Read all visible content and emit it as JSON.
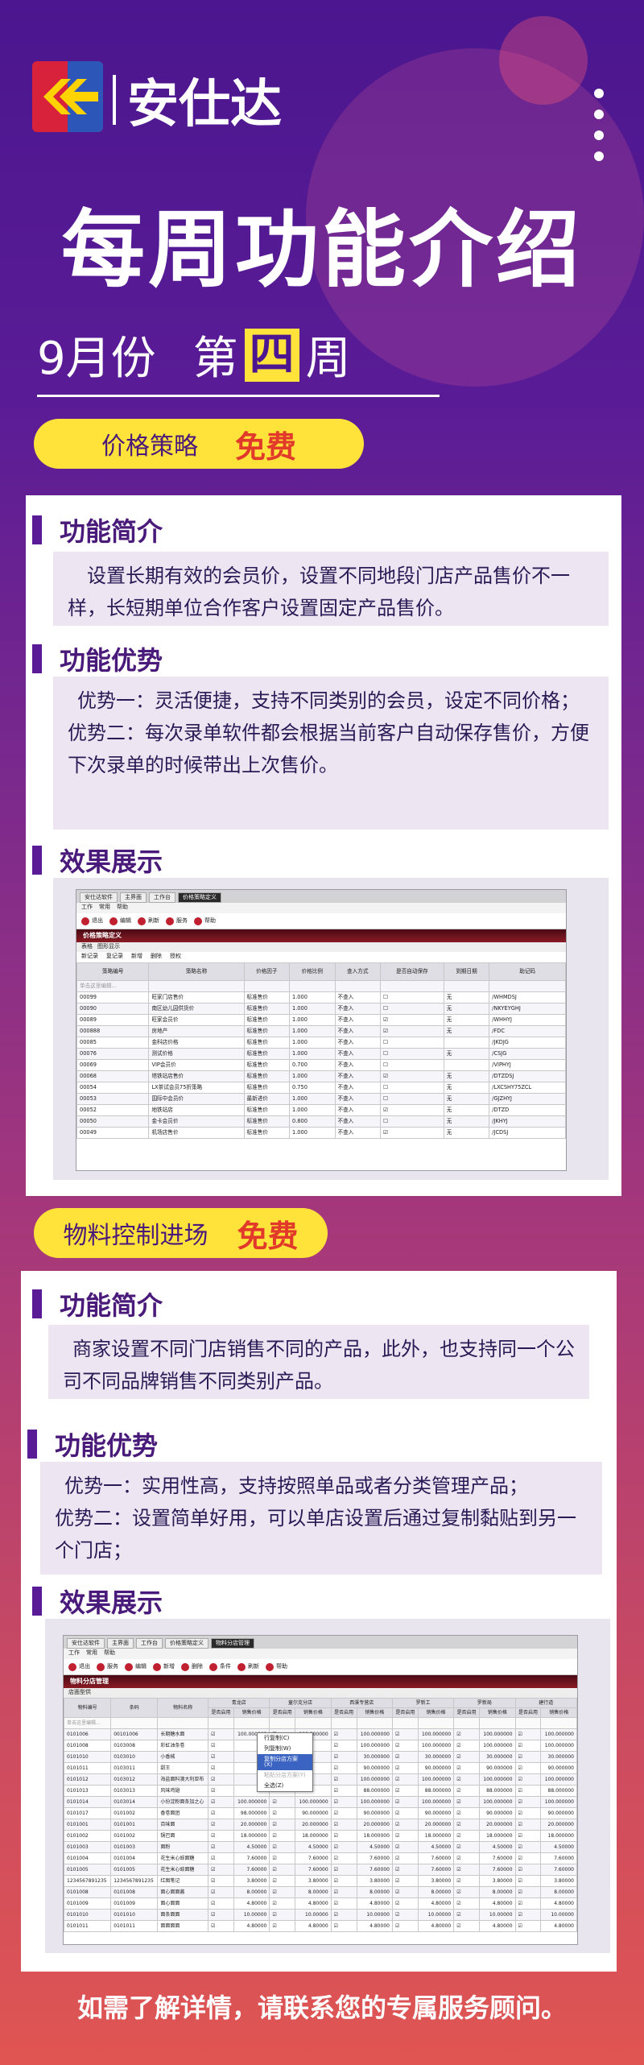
{
  "brand": {
    "name": "安仕达"
  },
  "poster": {
    "title": "每周功能介绍",
    "period_month": "9月份",
    "period_week_prefix": "第",
    "period_week_num": "四",
    "period_week_suffix": "周"
  },
  "feature1": {
    "name": "价格策略",
    "tag": "免费",
    "intro_title": "功能简介",
    "intro_text": "设置长期有效的会员价，设置不同地段门店产品售价不一样，长短期单位合作客户设置固定产品售价。",
    "adv_title": "功能优势",
    "adv_text1": "优势一：灵活便捷，支持不同类别的会员，设定不同价格；",
    "adv_text2": "优势二：每次录单软件都会根据当前客户自动保存售价，方便下次录单的时候带出上次售价。",
    "demo_title": "效果展示",
    "app": {
      "tabs": [
        "安仕达软件",
        "主界面",
        "工作台",
        "价格策略定义"
      ],
      "menu": [
        "工作",
        "常用",
        "帮助"
      ],
      "toolbar": [
        "退出",
        "编辑",
        "刷新",
        "服务",
        "帮助"
      ],
      "header": "价格策略定义",
      "subtabs": [
        "表格",
        "图形显示"
      ],
      "subtoolbar": [
        "新记录",
        "复记录",
        "新增",
        "删除",
        "授权"
      ],
      "columns": [
        "策略编号",
        "策略名称",
        "价格因子",
        "价格比例",
        "查入方式",
        "是否自动保存",
        "到期日期",
        "助记码"
      ],
      "filter": "单击这里编辑...",
      "rows": [
        [
          "00099",
          "旺家门店售价",
          "标准售价",
          "1.000",
          "不查入",
          "☐",
          "无",
          "/WHMDSJ"
        ],
        [
          "00090",
          "南区幼儿园供货价",
          "标准售价",
          "1.000",
          "不查入",
          "☐",
          "无",
          "/NKYEYGHJ"
        ],
        [
          "00089",
          "旺家会员价",
          "标准售价",
          "1.000",
          "不查入",
          "☑",
          "无",
          "/WHHYJ"
        ],
        [
          "000888",
          "房地产",
          "标准售价",
          "1.000",
          "不查入",
          "☑",
          "无",
          "/FDC"
        ],
        [
          "00085",
          "金科店价格",
          "标准售价",
          "1.000",
          "不查入",
          "☐",
          "",
          "/JKDJG"
        ],
        [
          "00076",
          "测试价格",
          "标准售价",
          "1.000",
          "不查入",
          "☐",
          "无",
          "/CSJG"
        ],
        [
          "00069",
          "VIP会员价",
          "标准售价",
          "0.700",
          "不查入",
          "☐",
          "",
          "/VIPHYJ"
        ],
        [
          "00068",
          "塔铁站店售价",
          "标准售价",
          "1.000",
          "不查入",
          "☑",
          "无",
          "/DTZDSJ"
        ],
        [
          "00054",
          "LX茶试会员75折策略",
          "标准售价",
          "0.750",
          "不查入",
          "☐",
          "无",
          "/LXCSHY75ZCL"
        ],
        [
          "00053",
          "国际中会员价",
          "最新进价",
          "1.000",
          "不查入",
          "☐",
          "无",
          "/GJZHYJ"
        ],
        [
          "00052",
          "地铁站店",
          "标准售价",
          "1.000",
          "不查入",
          "☑",
          "无",
          "/DTZD"
        ],
        [
          "00050",
          "金卡会员价",
          "标准售价",
          "0.800",
          "不查入",
          "☐",
          "无",
          "/JKHYJ"
        ],
        [
          "00049",
          "机场店售价",
          "标准售价",
          "1.000",
          "不查入",
          "☑",
          "无",
          "/JCDSJ"
        ]
      ]
    }
  },
  "feature2": {
    "name": "物料控制进场",
    "tag": "免费",
    "intro_title": "功能简介",
    "intro_text": "商家设置不同门店销售不同的产品，此外，也支持同一个公司不同品牌销售不同类别产品。",
    "adv_title": "功能优势",
    "adv_text1": "优势一：实用性高，支持按照单品或者分类管理产品；",
    "adv_text2": "优势二：设置简单好用，可以单店设置后通过复制黏贴到另一个门店；",
    "demo_title": "效果展示",
    "app": {
      "tabs": [
        "安仕达软件",
        "主界面",
        "工作台",
        "价格策略定义",
        "物料分店管理"
      ],
      "menu": [
        "工作",
        "常用",
        "帮助"
      ],
      "toolbar": [
        "退出",
        "服务",
        "编辑",
        "新增",
        "删除",
        "条件",
        "刷新",
        "帮助"
      ],
      "header": "物料分店管理",
      "subtab": "店面型供",
      "store_groups": [
        "青龙店",
        "童尔克分店",
        "西溪专营店",
        "罗新工",
        "罗新局",
        "建行道"
      ],
      "sub_cols": [
        "是否启用",
        "销售价格"
      ],
      "fixed_cols": [
        "物料编号",
        "条码",
        "物料名称"
      ],
      "filter": "单击这里编辑...",
      "context_menu": [
        "行复制(C)",
        "列复制(W)",
        "复制分店方案(X)",
        "粘贴分店方案(Y)",
        "全选(Z)"
      ],
      "rows": [
        [
          "0101006",
          "00101006",
          "长期糖水面",
          "100.000000",
          "100.000000",
          "100.000000",
          "100.000000",
          "100.000000",
          "100.000000"
        ],
        [
          "0101008",
          "0103008",
          "彩虹油条卷",
          "",
          "",
          "100.000000",
          "100.000000",
          "100.000000",
          "100.000000"
        ],
        [
          "0101010",
          "0103010",
          "小香械",
          "",
          "",
          "30.000000",
          "30.000000",
          "30.000000",
          "30.000000"
        ],
        [
          "0101011",
          "0103011",
          "甜王",
          "",
          "",
          "90.000000",
          "90.000000",
          "90.000000",
          "90.000000"
        ],
        [
          "0101012",
          "0103012",
          "海盐面料澳大利亚布",
          "",
          "",
          "100.000000",
          "100.000000",
          "100.000000",
          "100.000000"
        ],
        [
          "0101013",
          "0103013",
          "风味鸡翅",
          "",
          "",
          "88.000000",
          "88.000000",
          "88.000000",
          "88.000000"
        ],
        [
          "0101014",
          "0103014",
          "小份淀粉面条加之心",
          "100.000000",
          "100.000000",
          "100.000000",
          "100.000000",
          "100.000000",
          "100.000000"
        ],
        [
          "0101017",
          "0101002",
          "香卷面团",
          "98.000000",
          "90.000000",
          "90.000000",
          "90.000000",
          "90.000000",
          "90.000000"
        ],
        [
          "0101001",
          "0101001",
          "百味面",
          "20.000000",
          "20.000000",
          "20.000000",
          "20.000000",
          "20.000000",
          "20.000000"
        ],
        [
          "0101002",
          "0101002",
          "锅巴面",
          "18.000000",
          "18.000000",
          "18.000000",
          "18.000000",
          "18.000000",
          "18.000000"
        ],
        [
          "0101003",
          "0101003",
          "面粉",
          "4.50000",
          "4.50000",
          "4.50000",
          "4.50000",
          "4.50000",
          "4.50000"
        ],
        [
          "0101004",
          "0101004",
          "花生米心豉面糖",
          "7.60000",
          "7.60000",
          "7.60000",
          "7.60000",
          "7.60000",
          "7.60000"
        ],
        [
          "0101005",
          "0101005",
          "花生米心豉面糖",
          "7.60000",
          "7.60000",
          "7.60000",
          "7.60000",
          "7.60000",
          "7.60000"
        ],
        [
          "1234567891235",
          "1234567891235",
          "红图笔记",
          "3.80000",
          "3.80000",
          "3.80000",
          "3.80000",
          "3.80000",
          "3.80000"
        ],
        [
          "0101008",
          "0101008",
          "面心面面酱",
          "8.00000",
          "8.00000",
          "8.00000",
          "8.00000",
          "8.00000",
          "8.00000"
        ],
        [
          "0101009",
          "0101009",
          "面心面面",
          "4.80000",
          "4.80000",
          "4.80000",
          "4.80000",
          "4.80000",
          "4.80000"
        ],
        [
          "0101010",
          "0101010",
          "面条面面",
          "10.00000",
          "10.00000",
          "10.00000",
          "10.00000",
          "10.00000",
          "10.00000"
        ],
        [
          "0101011",
          "0101011",
          "面面面面",
          "4.80000",
          "4.80000",
          "4.80000",
          "4.80000",
          "4.80000",
          "4.80000"
        ]
      ]
    }
  },
  "footer": {
    "text": "如需了解详情，请联系您的专属服务顾问。"
  }
}
